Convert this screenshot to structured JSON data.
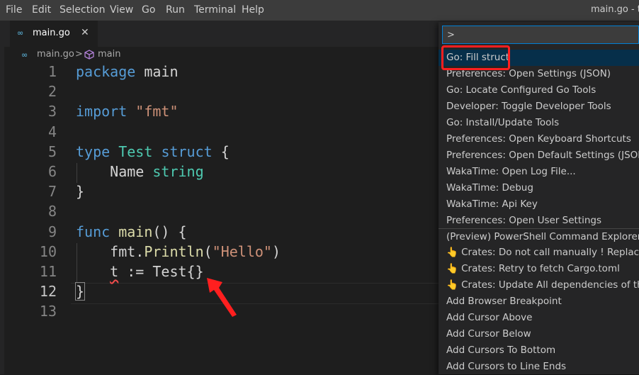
{
  "menubar": {
    "items": [
      "File",
      "Edit",
      "Selection",
      "View",
      "Go",
      "Run",
      "Terminal",
      "Help"
    ],
    "window_title": "main.go - te"
  },
  "tab": {
    "label": "main.go",
    "close": "✕",
    "icon": "go-file-icon"
  },
  "breadcrumb": {
    "file": "main.go",
    "separator": ">",
    "symbol": "main",
    "symbol_icon": "module-icon"
  },
  "editor": {
    "line_numbers": [
      "1",
      "2",
      "3",
      "4",
      "5",
      "6",
      "7",
      "8",
      "9",
      "10",
      "11",
      "12",
      "13"
    ],
    "active_line": "12",
    "lines": [
      [
        {
          "t": "package",
          "c": "kw"
        },
        {
          "t": " main",
          "c": ""
        }
      ],
      [],
      [
        {
          "t": "import",
          "c": "kw"
        },
        {
          "t": " ",
          "c": ""
        },
        {
          "t": "\"fmt\"",
          "c": "str"
        }
      ],
      [],
      [
        {
          "t": "type",
          "c": "kw"
        },
        {
          "t": " ",
          "c": ""
        },
        {
          "t": "Test",
          "c": "typ"
        },
        {
          "t": " ",
          "c": ""
        },
        {
          "t": "struct",
          "c": "kw"
        },
        {
          "t": " {",
          "c": ""
        }
      ],
      [
        {
          "t": "    Name ",
          "c": ""
        },
        {
          "t": "string",
          "c": "typ"
        }
      ],
      [
        {
          "t": "}",
          "c": ""
        }
      ],
      [],
      [
        {
          "t": "func",
          "c": "kw"
        },
        {
          "t": " ",
          "c": ""
        },
        {
          "t": "main",
          "c": "fn"
        },
        {
          "t": "() {",
          "c": ""
        }
      ],
      [
        {
          "t": "    fmt.",
          "c": ""
        },
        {
          "t": "Println",
          "c": "fn"
        },
        {
          "t": "(",
          "c": ""
        },
        {
          "t": "\"Hello\"",
          "c": "str"
        },
        {
          "t": ")",
          "c": ""
        }
      ],
      [
        {
          "t": "    ",
          "c": ""
        },
        {
          "t": "t",
          "c": "sq"
        },
        {
          "t": " := Test{}",
          "c": ""
        }
      ],
      [
        {
          "t": "}",
          "c": "box"
        }
      ],
      []
    ]
  },
  "palette": {
    "input_value": ">",
    "items": [
      "Go: Fill struct",
      "Preferences: Open Settings (JSON)",
      "Go: Locate Configured Go Tools",
      "Developer: Toggle Developer Tools",
      "Go: Install/Update Tools",
      "Preferences: Open Keyboard Shortcuts",
      "Preferences: Open Default Settings (JSON)",
      "WakaTime: Open Log File...",
      "WakaTime: Debug",
      "WakaTime: Api Key",
      "Preferences: Open User Settings",
      "(Preview) PowerShell Command Explorer: Focu",
      "👆 Crates: Do not call manually ! Replace Versi",
      "👆 Crates: Retry to fetch Cargo.toml",
      "👆 Crates: Update All dependencies of the Car",
      "Add Browser Breakpoint",
      "Add Cursor Above",
      "Add Cursor Below",
      "Add Cursors To Bottom",
      "Add Cursors to Line Ends"
    ],
    "selected_index": 0,
    "separator_before_index": 11
  },
  "annotations": {
    "highlight_color": "#ff1f1f",
    "arrow_color": "#ff1f1f"
  }
}
